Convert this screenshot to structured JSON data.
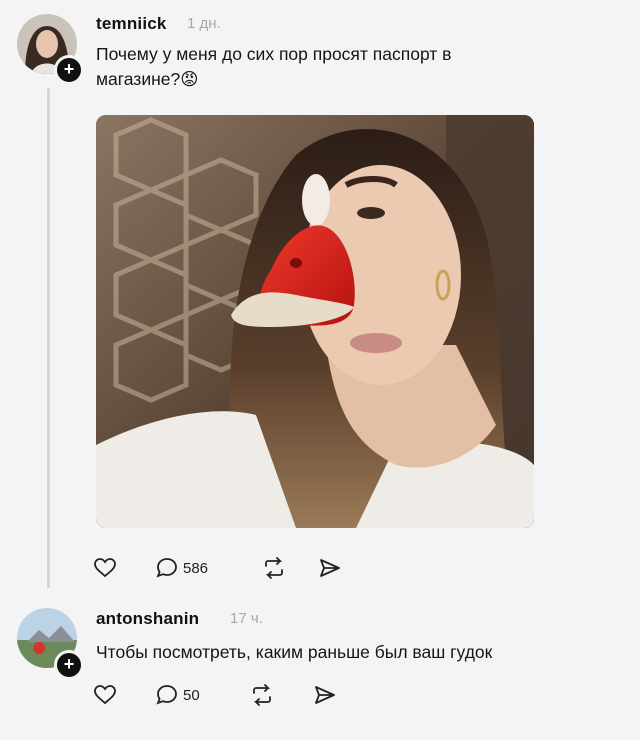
{
  "post": {
    "username": "temniick",
    "time": "1 дн.",
    "text_line1": "Почему у меня до сих пор просят паспорт в",
    "text_line2": "магазине?😡",
    "reply_count": "586"
  },
  "reply": {
    "username": "antonshanin",
    "time": "17 ч.",
    "text": "Чтобы посмотреть, каким раньше был ваш гудок",
    "reply_count": "50"
  },
  "icons": {
    "like": "heart-icon",
    "comment": "comment-bubble-icon",
    "repost": "repost-icon",
    "share": "send-icon",
    "follow": "plus-icon"
  },
  "colors": {
    "background": "#f4f4f4",
    "text": "#111111",
    "muted": "#a8a8a8",
    "beak": "#d81e1e"
  }
}
